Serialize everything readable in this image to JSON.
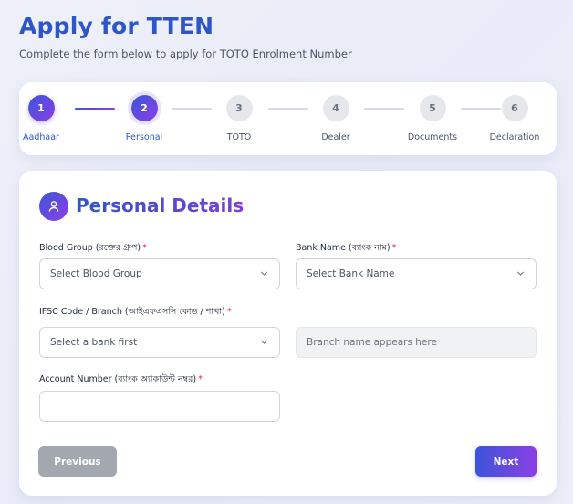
{
  "header": {
    "title": "Apply for TTEN",
    "subtitle": "Complete the form below to apply for TOTO Enrolment Number"
  },
  "stepper": {
    "steps": [
      {
        "number": "1",
        "label": "Aadhaar",
        "state": "done"
      },
      {
        "number": "2",
        "label": "Personal",
        "state": "active"
      },
      {
        "number": "3",
        "label": "TOTO",
        "state": "pending"
      },
      {
        "number": "4",
        "label": "Dealer",
        "state": "pending"
      },
      {
        "number": "5",
        "label": "Documents",
        "state": "pending"
      },
      {
        "number": "6",
        "label": "Declaration",
        "state": "pending"
      }
    ]
  },
  "section": {
    "icon": "user-icon",
    "title": "Personal Details"
  },
  "fields": {
    "blood_group": {
      "label": "Blood Group (রক্তের গ্রুপ)",
      "required": "*",
      "value": "Select Blood Group"
    },
    "bank_name": {
      "label": "Bank Name (ব্যাংক নাম)",
      "required": "*",
      "value": "Select Bank Name"
    },
    "ifsc": {
      "label": "IFSC Code / Branch (আইএফএসসি কোড / শাখা)",
      "required": "*",
      "value": "Select a bank first"
    },
    "branch": {
      "placeholder": "Branch name appears here"
    },
    "account_number": {
      "label": "Account Number (ব্যাংক অ্যাকাউন্ট নম্বর)",
      "required": "*",
      "value": ""
    }
  },
  "actions": {
    "previous_label": "Previous",
    "next_label": "Next"
  },
  "colors": {
    "accent_start": "#3b55d9",
    "accent_end": "#8b3fe6",
    "title": "#2f56c8",
    "required": "#e11d48"
  }
}
